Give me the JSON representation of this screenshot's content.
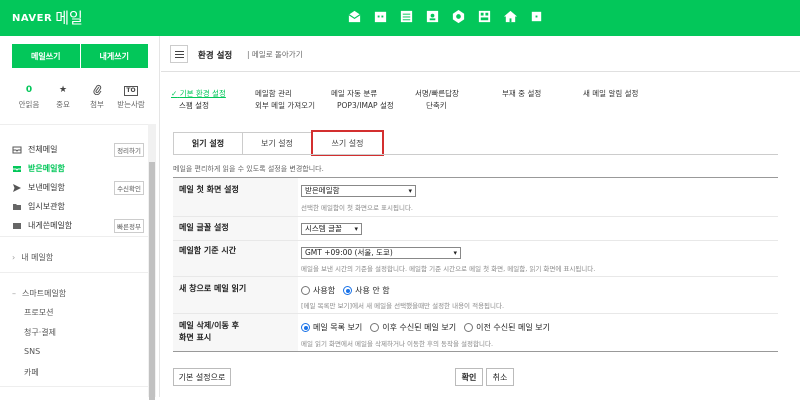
{
  "header": {
    "brand": "NAVER",
    "app_name": "메일",
    "app_icons": [
      "mail-app-icon",
      "calendar-app-icon",
      "list-app-icon",
      "contacts-app-icon",
      "drive-app-icon",
      "memo-app-icon",
      "home-app-icon",
      "more-app-icon"
    ],
    "colors": {
      "brand_green": "#03c75a"
    }
  },
  "sidebar": {
    "write_label": "메일쓰기",
    "self_write_label": "내게쓰기",
    "quick": [
      {
        "top": "0",
        "label": "안읽음"
      },
      {
        "top": "★",
        "label": "중요"
      },
      {
        "top": "📎",
        "label": "첨부"
      },
      {
        "top": "TO",
        "label": "받는사람"
      }
    ],
    "folders": [
      {
        "label": "전체메일",
        "button": "정리하기",
        "icon": "inbox-all-icon"
      },
      {
        "label": "받은메일함",
        "button": "",
        "icon": "inbox-icon"
      },
      {
        "label": "보낸메일함",
        "button": "수신확인",
        "icon": "send-icon"
      },
      {
        "label": "임시보관함",
        "button": "",
        "icon": "draft-icon"
      },
      {
        "label": "내게쓴메일함",
        "button": "빠른정부",
        "icon": "self-mail-icon"
      }
    ],
    "my_mailbox": "내 메일함",
    "smart_mailbox": "스마트메일함",
    "smart_items": [
      "프로모션",
      "청구·결제",
      "SNS",
      "카페"
    ]
  },
  "main": {
    "title": "환경 설정",
    "back_link": "메일로 돌아가기",
    "nav_row1": [
      "기본 환경 설정",
      "메일함 관리",
      "메일 자동 분류",
      "서명/빠른답장",
      "부재 중 설정",
      "새 메일 알림 설정"
    ],
    "nav_row2": [
      "스팸 설정",
      "외부 메일 가져오기",
      "POP3/IMAP 설정",
      "단축키"
    ],
    "tabs": [
      "읽기 설정",
      "보기 설정",
      "쓰기 설정"
    ],
    "description": "메일을 편리하게 읽을 수 있도록 설정을 변경합니다.",
    "rows": {
      "first_screen": {
        "label": "메일 첫 화면 설정",
        "value": "받은메일함",
        "help": "선택한 메일함이 첫 화면으로 표시됩니다."
      },
      "font": {
        "label": "메일 글꼴 설정",
        "value": "시스템 글꼴"
      },
      "time": {
        "label": "메일함 기준 시간",
        "value": "GMT +09:00 (서울, 도쿄)",
        "help": "메일을 보낸 시간의 기준을 설정합니다. 메일함 기준 시간으로 메일 첫 화면, 메일함, 읽기 화면에 표시됩니다."
      },
      "new_window": {
        "label": "새 창으로 메일 읽기",
        "options": [
          "사용함",
          "사용 안 함"
        ],
        "help": "[메일 목록만 보기]에서 새 메일을 선택했을때만 설정한 내용이 적용됩니다."
      },
      "after_delete": {
        "label_line1": "메일 삭제/이동 후",
        "label_line2": "화면 표시",
        "options": [
          "메일 목록 보기",
          "이후 수신된 메일 보기",
          "이전 수신된 메일 보기"
        ],
        "help": "메일 읽기 화면에서 메일을 삭제하거나 이동한 후의 동작을 설정합니다."
      }
    },
    "buttons": {
      "reset": "기본 설정으로",
      "confirm": "확인",
      "cancel": "취소"
    }
  }
}
